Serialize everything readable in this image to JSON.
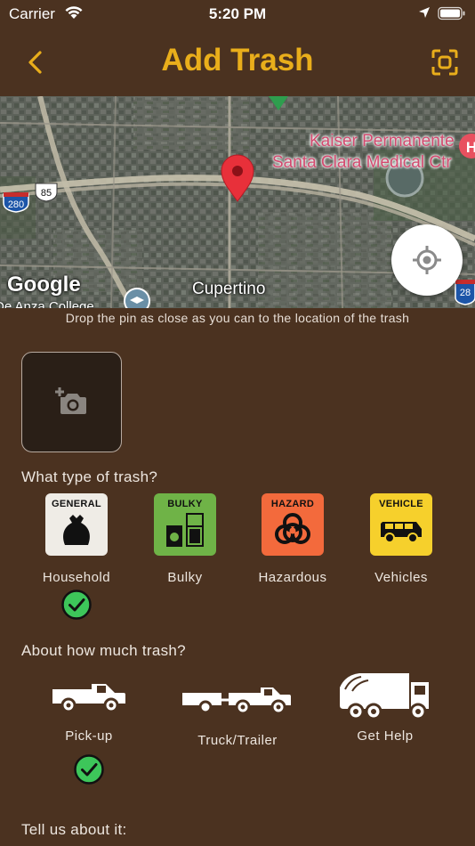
{
  "status_bar": {
    "carrier": "Carrier",
    "time": "5:20 PM"
  },
  "nav": {
    "title": "Add Trash",
    "back_icon": "chevron-left-icon",
    "scan_icon": "scan-frame-icon"
  },
  "map": {
    "poi": [
      "Kaiser Permanente",
      "Santa Clara Medical Ctr"
    ],
    "city": "Cupertino",
    "college": "De Anza College",
    "highways": [
      "280",
      "85",
      "28"
    ],
    "logo": "Google",
    "hint": "Drop the pin as close as you can to the location of the trash"
  },
  "photo": {
    "icon": "add-photo-icon"
  },
  "trash_type": {
    "question": "What type of trash?",
    "options": [
      {
        "badge": "GENERAL",
        "label": "Household",
        "color": "#efece6",
        "selected": true
      },
      {
        "badge": "BULKY",
        "label": "Bulky",
        "color": "#6fb347",
        "selected": false
      },
      {
        "badge": "HAZARD",
        "label": "Hazardous",
        "color": "#f36a3c",
        "selected": false
      },
      {
        "badge": "VEHICLE",
        "label": "Vehicles",
        "color": "#f6d02c",
        "selected": false
      }
    ]
  },
  "amount": {
    "question": "About how much trash?",
    "options": [
      {
        "label": "Pick-up",
        "selected": true
      },
      {
        "label": "Truck/Trailer",
        "selected": false
      },
      {
        "label": "Get Help",
        "selected": false
      }
    ]
  },
  "details": {
    "question": "Tell us about it:"
  },
  "colors": {
    "background": "#4b3220",
    "accent": "#e9ae1b",
    "check": "#3dc65a",
    "pin": "#e8303a"
  }
}
